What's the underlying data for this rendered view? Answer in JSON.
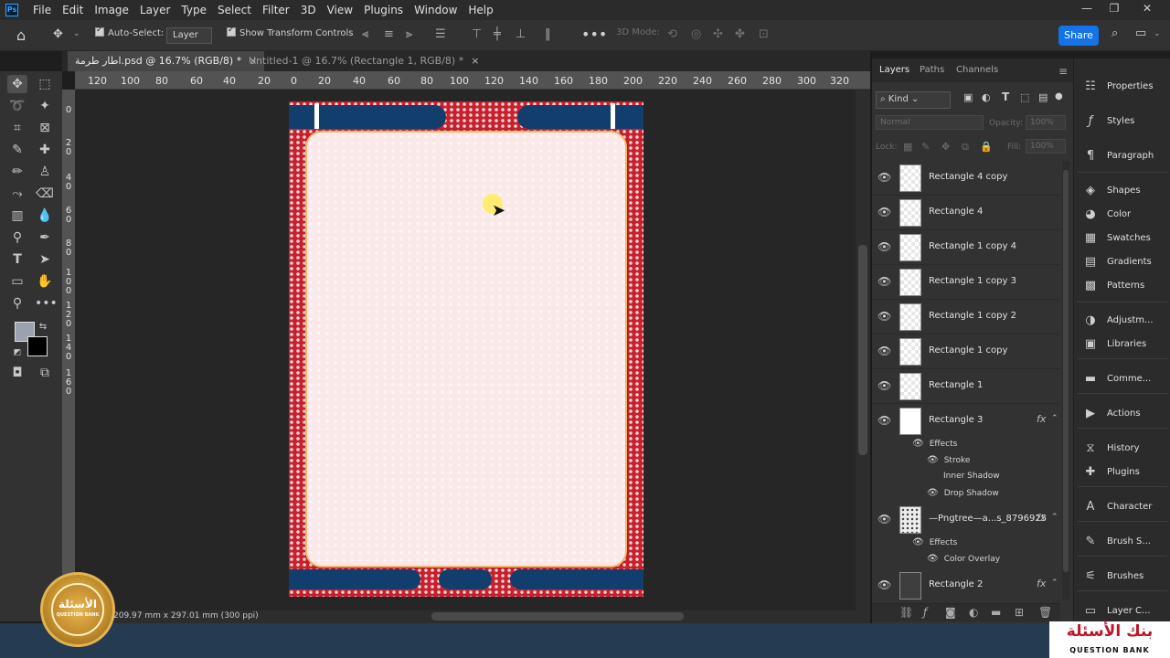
{
  "app": {
    "logo_text": "Ps"
  },
  "menu": [
    "File",
    "Edit",
    "Image",
    "Layer",
    "Type",
    "Select",
    "Filter",
    "3D",
    "View",
    "Plugins",
    "Window",
    "Help"
  ],
  "window_controls": [
    "—",
    "❐",
    "✕"
  ],
  "options_bar": {
    "auto_select_label": "Auto-Select:",
    "auto_select_value": "Layer",
    "show_transform_label": "Show Transform Controls",
    "three_d_mode_label": "3D Mode:",
    "share_label": "Share"
  },
  "tabs": [
    {
      "label": "اطار طرمة.psd @ 16.7% (RGB/8) *",
      "close": "×"
    },
    {
      "label": "Untitled-1 @ 16.7% (Rectangle 1, RGB/8) *",
      "close": "×"
    }
  ],
  "ruler_h": [
    "120",
    "100",
    "80",
    "60",
    "40",
    "20",
    "0",
    "20",
    "40",
    "60",
    "80",
    "100",
    "120",
    "140",
    "160",
    "180",
    "200",
    "220",
    "240",
    "260",
    "280",
    "300",
    "320"
  ],
  "ruler_v": [
    "0",
    "2",
    "0",
    "4",
    "0",
    "6",
    "0",
    "8",
    "0",
    "1",
    "0",
    "0",
    "1",
    "2",
    "0",
    "1",
    "4",
    "0",
    "1",
    "6",
    "0"
  ],
  "status": {
    "doc_info": "209.97 mm x 297.01 mm (300 ppi)"
  },
  "layers_panel": {
    "tabs": [
      "Layers",
      "Paths",
      "Channels"
    ],
    "kind_label": "Kind",
    "blend_mode": "Normal",
    "opacity_label": "Opacity:",
    "opacity_value": "100%",
    "lock_label": "Lock:",
    "fill_label": "Fill:",
    "fill_value": "100%",
    "layers": [
      {
        "name": "Rectangle 4 copy",
        "thumb": "checker"
      },
      {
        "name": "Rectangle 4",
        "thumb": "checker"
      },
      {
        "name": "Rectangle 1 copy 4",
        "thumb": "checker"
      },
      {
        "name": "Rectangle 1 copy 3",
        "thumb": "checker"
      },
      {
        "name": "Rectangle 1 copy 2",
        "thumb": "checker"
      },
      {
        "name": "Rectangle 1 copy",
        "thumb": "checker"
      },
      {
        "name": "Rectangle 1",
        "thumb": "checker"
      },
      {
        "name": "Rectangle 3",
        "thumb": "white",
        "fx": "fx"
      }
    ],
    "rect3_effects": {
      "title": "Effects",
      "items": [
        "Stroke",
        "Inner Shadow",
        "Drop Shadow"
      ]
    },
    "layer_pattern": {
      "name": "—Pngtree—a...s_8796925",
      "fx": "fx"
    },
    "pattern_effects": {
      "title": "Effects",
      "items": [
        "Color Overlay"
      ]
    },
    "layer_bottom": {
      "name": "Rectangle 2",
      "fx": "fx"
    }
  },
  "right_dock": [
    "Properties",
    "Styles",
    "Paragraph",
    "Shapes",
    "Color",
    "Swatches",
    "Gradients",
    "Patterns",
    "Adjustm...",
    "Libraries",
    "Comme...",
    "Actions",
    "History",
    "Plugins",
    "Character",
    "Brush S...",
    "Brushes",
    "Layer C..."
  ],
  "watermark": {
    "ar_text": "بنك الأسئلة",
    "en_text": "QUESTION BANK",
    "badge_ar": "الأسئلة",
    "badge_en": "QUESTION BANK"
  },
  "colors": {
    "accent": "#1473e6",
    "navy": "#123e6d",
    "red": "#c8202c",
    "panel": "#fbe9e9",
    "stroke": "#f2b66a"
  }
}
